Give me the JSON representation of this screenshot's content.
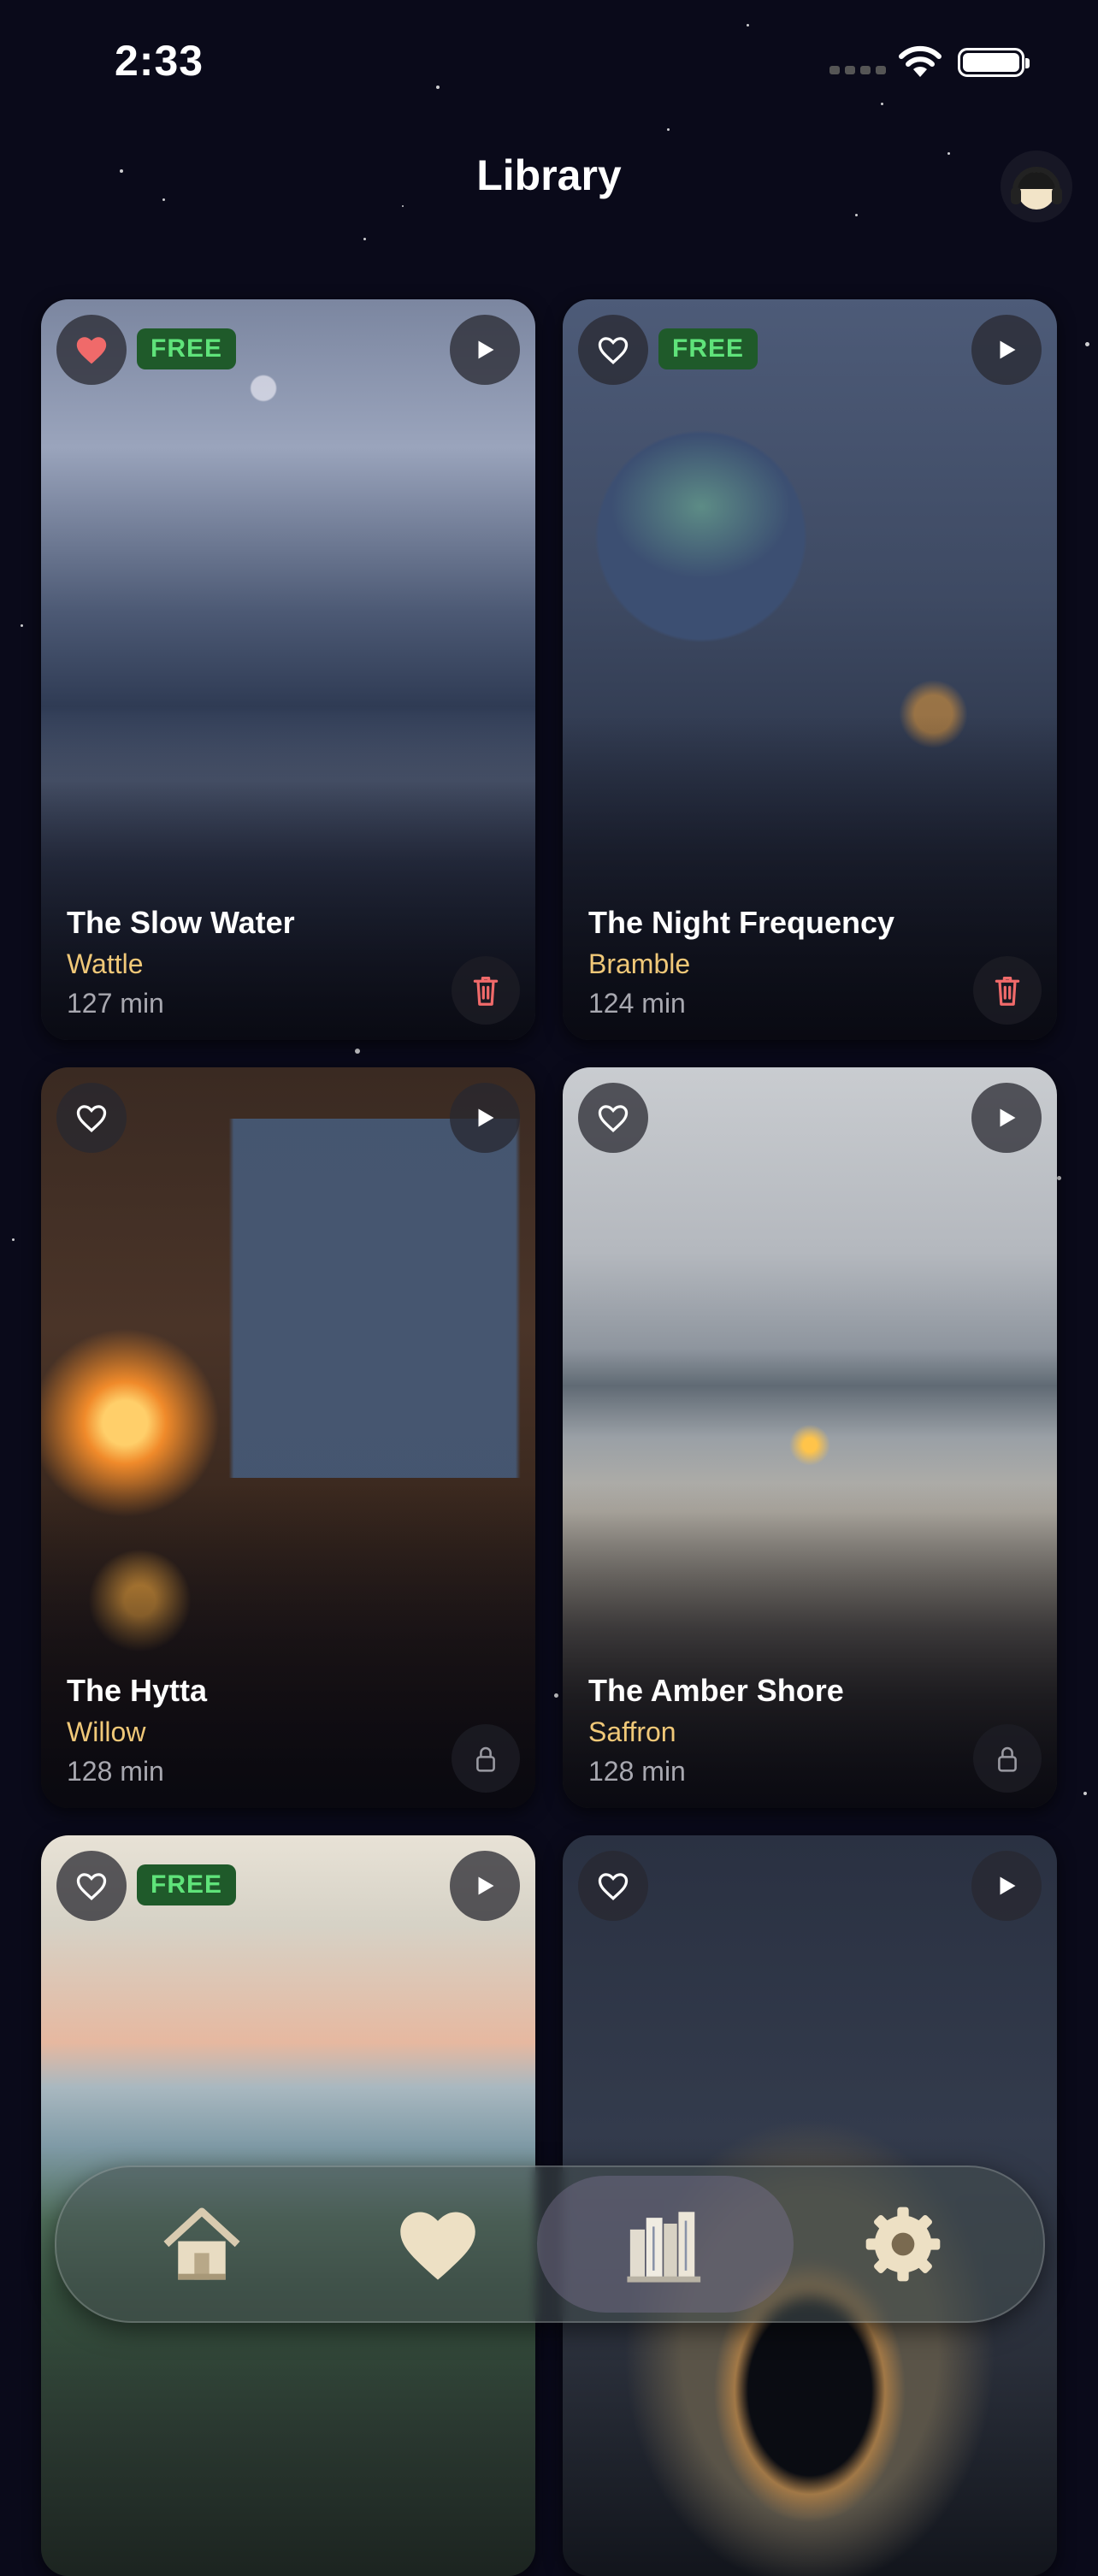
{
  "status_bar": {
    "time": "2:33"
  },
  "header": {
    "title": "Library"
  },
  "cards": [
    {
      "title": "The Slow Water",
      "narrator": "Wattle",
      "duration": "127 min",
      "badge": "FREE",
      "favorited": true,
      "action": "delete"
    },
    {
      "title": "The Night Frequency",
      "narrator": "Bramble",
      "duration": "124 min",
      "badge": "FREE",
      "favorited": false,
      "action": "delete"
    },
    {
      "title": "The Hytta",
      "narrator": "Willow",
      "duration": "128 min",
      "badge": "",
      "favorited": false,
      "action": "locked"
    },
    {
      "title": "The Amber Shore",
      "narrator": "Saffron",
      "duration": "128 min",
      "badge": "",
      "favorited": false,
      "action": "locked"
    },
    {
      "title": "",
      "narrator": "",
      "duration": "",
      "badge": "FREE",
      "favorited": false,
      "action": ""
    },
    {
      "title": "",
      "narrator": "",
      "duration": "",
      "badge": "",
      "favorited": false,
      "action": ""
    }
  ],
  "tab_bar": {
    "tabs": [
      {
        "name": "home",
        "icon": "home-icon",
        "active": false
      },
      {
        "name": "favorites",
        "icon": "heart-icon",
        "active": false
      },
      {
        "name": "library",
        "icon": "books-icon",
        "active": true
      },
      {
        "name": "settings",
        "icon": "gear-icon",
        "active": false
      }
    ]
  },
  "colors": {
    "background": "#0a0a1a",
    "narrator": "#f0c878",
    "free_badge_text": "#5fe37a",
    "free_badge_bg": "#1f5a2a",
    "favorite": "#f06a6a",
    "delete": "#f06a6a"
  }
}
